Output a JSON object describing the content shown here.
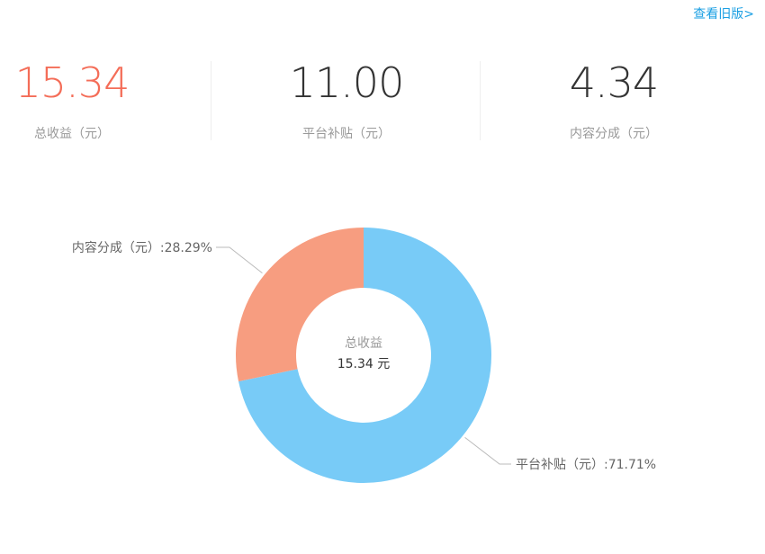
{
  "header": {
    "old_version_link": "查看旧版>"
  },
  "stats": [
    {
      "value": "15.34",
      "label": "总收益（元）",
      "accent": true
    },
    {
      "value": "11.00",
      "label": "平台补贴（元）",
      "accent": false
    },
    {
      "value": "4.34",
      "label": "内容分成（元）",
      "accent": false
    }
  ],
  "chart_data": {
    "type": "pie",
    "title": "",
    "center": {
      "title": "总收益",
      "value": "15.34 元"
    },
    "slices": [
      {
        "label": "平台补贴（元）",
        "percent": 71.71,
        "value": 11.0,
        "color": "#78cbf7",
        "label_text": "平台补贴（元）:71.71%"
      },
      {
        "label": "内容分成（元）",
        "percent": 28.29,
        "value": 4.34,
        "color": "#f79d80",
        "label_text": "内容分成（元）:28.29%"
      }
    ]
  },
  "colors": {
    "accent": "#f46d58",
    "link": "#1a9fe3"
  }
}
